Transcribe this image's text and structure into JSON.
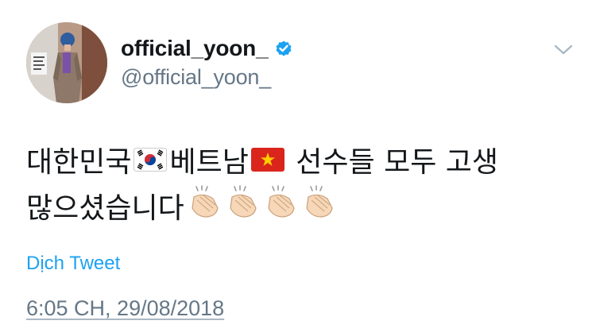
{
  "tweet": {
    "display_name": "official_yoon_",
    "handle": "@official_yoon_",
    "verified": true,
    "text_line1_a": "대한민국",
    "text_line1_b": "베트남",
    "text_line1_c": " 선수들 모두 고생",
    "text_line2": "많으셨습니다",
    "emoji": {
      "flag_1": "south-korea-flag",
      "flag_2": "vietnam-flag",
      "clap_count": 4
    },
    "translate_label": "Dịch Tweet",
    "timestamp": "6:05 CH, 29/08/2018"
  },
  "colors": {
    "link_blue": "#1da1f2",
    "secondary_gray": "#657786",
    "text_dark": "#14171a"
  }
}
